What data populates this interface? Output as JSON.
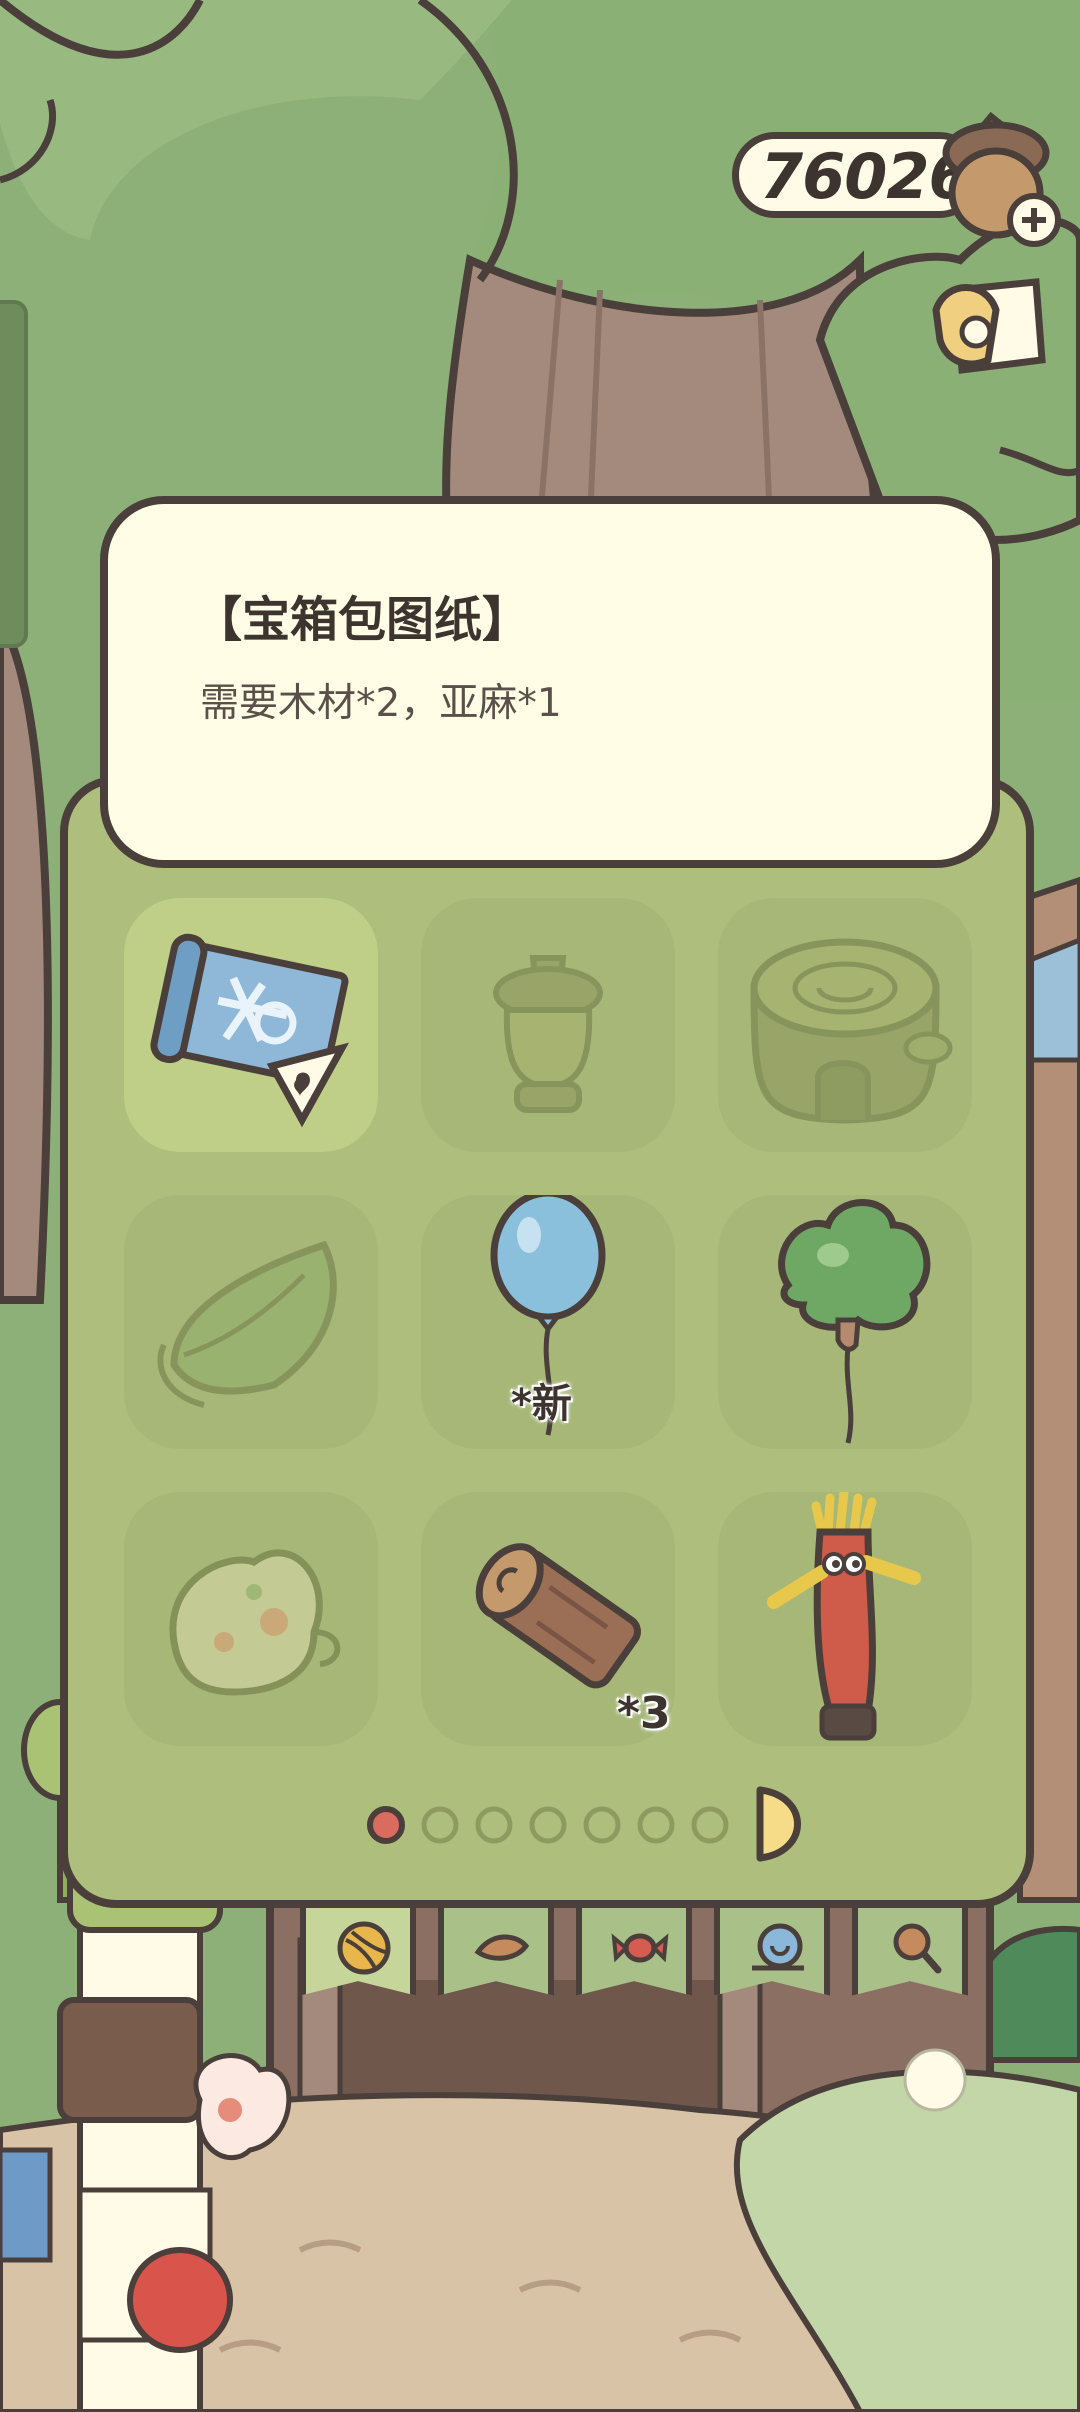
{
  "currency": {
    "amount": "76026",
    "icon": "acorn-plus-icon"
  },
  "hud": {
    "mail_icon": "mail-envelope-icon"
  },
  "info_card": {
    "title": "【宝箱包图纸】",
    "description": "需要木材*2，亚麻*1"
  },
  "inventory": {
    "items": [
      {
        "icon": "blueprint-scroll-icon",
        "state": "selected",
        "badge": ""
      },
      {
        "icon": "acorn-lamp-icon",
        "state": "faded",
        "badge": ""
      },
      {
        "icon": "stump-house-icon",
        "state": "faded",
        "badge": ""
      },
      {
        "icon": "leaf-wrap-icon",
        "state": "faded",
        "badge": ""
      },
      {
        "icon": "blue-balloon-icon",
        "state": "normal",
        "badge": "*新"
      },
      {
        "icon": "green-cloud-balloon-icon",
        "state": "normal",
        "badge": ""
      },
      {
        "icon": "flower-bag-icon",
        "state": "faded",
        "badge": ""
      },
      {
        "icon": "wood-log-icon",
        "state": "normal",
        "badge": "*3"
      },
      {
        "icon": "tube-man-icon",
        "state": "normal",
        "badge": ""
      }
    ],
    "pagination": {
      "current": 1,
      "total": 7
    },
    "next_icon": "next-arrow-icon"
  },
  "tabs": [
    {
      "icon": "yarn-ball-icon",
      "active": true
    },
    {
      "icon": "leaf-food-icon",
      "active": false
    },
    {
      "icon": "candy-icon",
      "active": false
    },
    {
      "icon": "snail-shell-icon",
      "active": false
    },
    {
      "icon": "magnifier-icon",
      "active": false
    }
  ],
  "colors": {
    "sky_green": "#8db078",
    "outline": "#4a3f3a",
    "card_bg": "#fffde5",
    "panel_bg": "#aebe7d",
    "dot_active": "#d96b5f"
  }
}
